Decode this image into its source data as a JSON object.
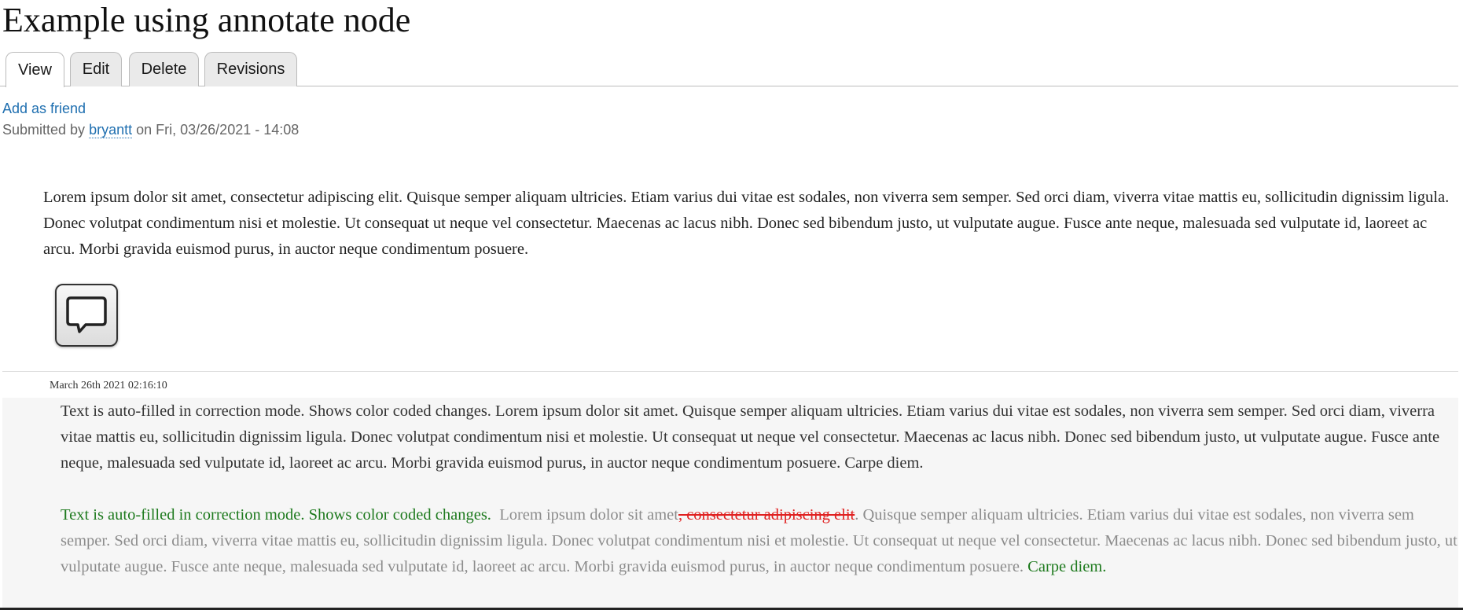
{
  "page": {
    "title": "Example using annotate node"
  },
  "tabs": [
    {
      "label": "View",
      "active": true
    },
    {
      "label": "Edit",
      "active": false
    },
    {
      "label": "Delete",
      "active": false
    },
    {
      "label": "Revisions",
      "active": false
    }
  ],
  "links": {
    "add_friend": "Add as friend"
  },
  "submitted": {
    "prefix": "Submitted by",
    "author": "bryantt",
    "suffix": "on Fri, 03/26/2021 - 14:08"
  },
  "content": {
    "body": "Lorem ipsum dolor sit amet, consectetur adipiscing elit. Quisque semper aliquam ultricies. Etiam varius dui vitae est sodales, non viverra sem semper. Sed orci diam, viverra vitae mattis eu, sollicitudin dignissim ligula. Donec volutpat condimentum nisi et molestie. Ut consequat ut neque vel consectetur. Maecenas ac lacus nibh. Donec sed bibendum justo, ut vulputate augue. Fusce ante neque, malesuada sed vulputate id, laoreet ac arcu. Morbi gravida euismod purus, in auctor neque condimentum posuere."
  },
  "annotate_button": {
    "icon": "speech-bubble-icon"
  },
  "annotation": {
    "date": "March 26th 2021 02:16:10",
    "text": "Text is auto-filled in correction mode.  Shows color coded changes.  Lorem ipsum dolor sit amet. Quisque semper aliquam ultricies. Etiam varius dui vitae est sodales, non viverra sem semper. Sed orci diam, viverra vitae mattis eu, sollicitudin dignissim ligula. Donec volutpat condimentum nisi et molestie. Ut consequat ut neque vel consectetur. Maecenas ac lacus nibh. Donec sed bibendum justo, ut vulputate augue. Fusce ante neque, malesuada sed vulputate id, laoreet ac arcu. Morbi gravida euismod purus, in auctor neque condimentum posuere. Carpe diem.",
    "diff": {
      "added_intro": "Text is auto-filled in correction mode.  Shows color coded changes.",
      "unchanged_1": "Lorem ipsum dolor sit amet",
      "deleted": ", consectetur adipiscing elit",
      "unchanged_2": ". Quisque semper aliquam ultricies. Etiam varius dui vitae est sodales, non viverra sem semper. Sed orci diam, viverra vitae mattis eu, sollicitudin dignissim ligula. Donec volutpat condimentum nisi et molestie. Ut consequat ut neque vel consectetur. Maecenas ac lacus nibh. Donec sed bibendum justo, ut vulputate augue. Fusce ante neque, malesuada sed vulputate id, laoreet ac arcu. Morbi gravida euismod purus, in auctor neque condimentum posuere.",
      "added_outro": "Carpe diem."
    },
    "colors": {
      "added": "#1e7a1e",
      "deleted": "#e02020",
      "unchanged": "#8c8c8c"
    }
  }
}
